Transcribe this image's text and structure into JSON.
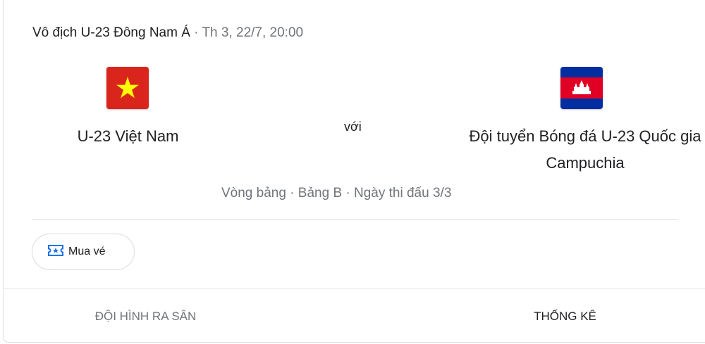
{
  "header": {
    "competition": "Vô địch U-23 Đông Nam Á",
    "separator": " · ",
    "datetime": "Th 3, 22/7, 20:00"
  },
  "match": {
    "home_team": "U-23 Việt Nam",
    "home_flag_icon": "vietnam-flag-icon",
    "vs_label": "với",
    "away_team": "Đội tuyển Bóng đá U-23 Quốc gia Campuchia",
    "away_flag_icon": "cambodia-flag-icon",
    "meta": "Vòng bảng · Bảng B · Ngày thi đấu 3/3"
  },
  "actions": {
    "ticket_label": "Mua vé",
    "ticket_icon": "ticket-icon"
  },
  "tabs": [
    {
      "label": "ĐỘI HÌNH RA SÂN"
    },
    {
      "label": "THỐNG KÊ"
    }
  ],
  "colors": {
    "vn_red": "#da251d",
    "vn_star": "#ffff00",
    "kh_blue": "#032ea1",
    "kh_red": "#e00025",
    "ticket_blue": "#1a73e8",
    "muted_text": "#70757a"
  }
}
